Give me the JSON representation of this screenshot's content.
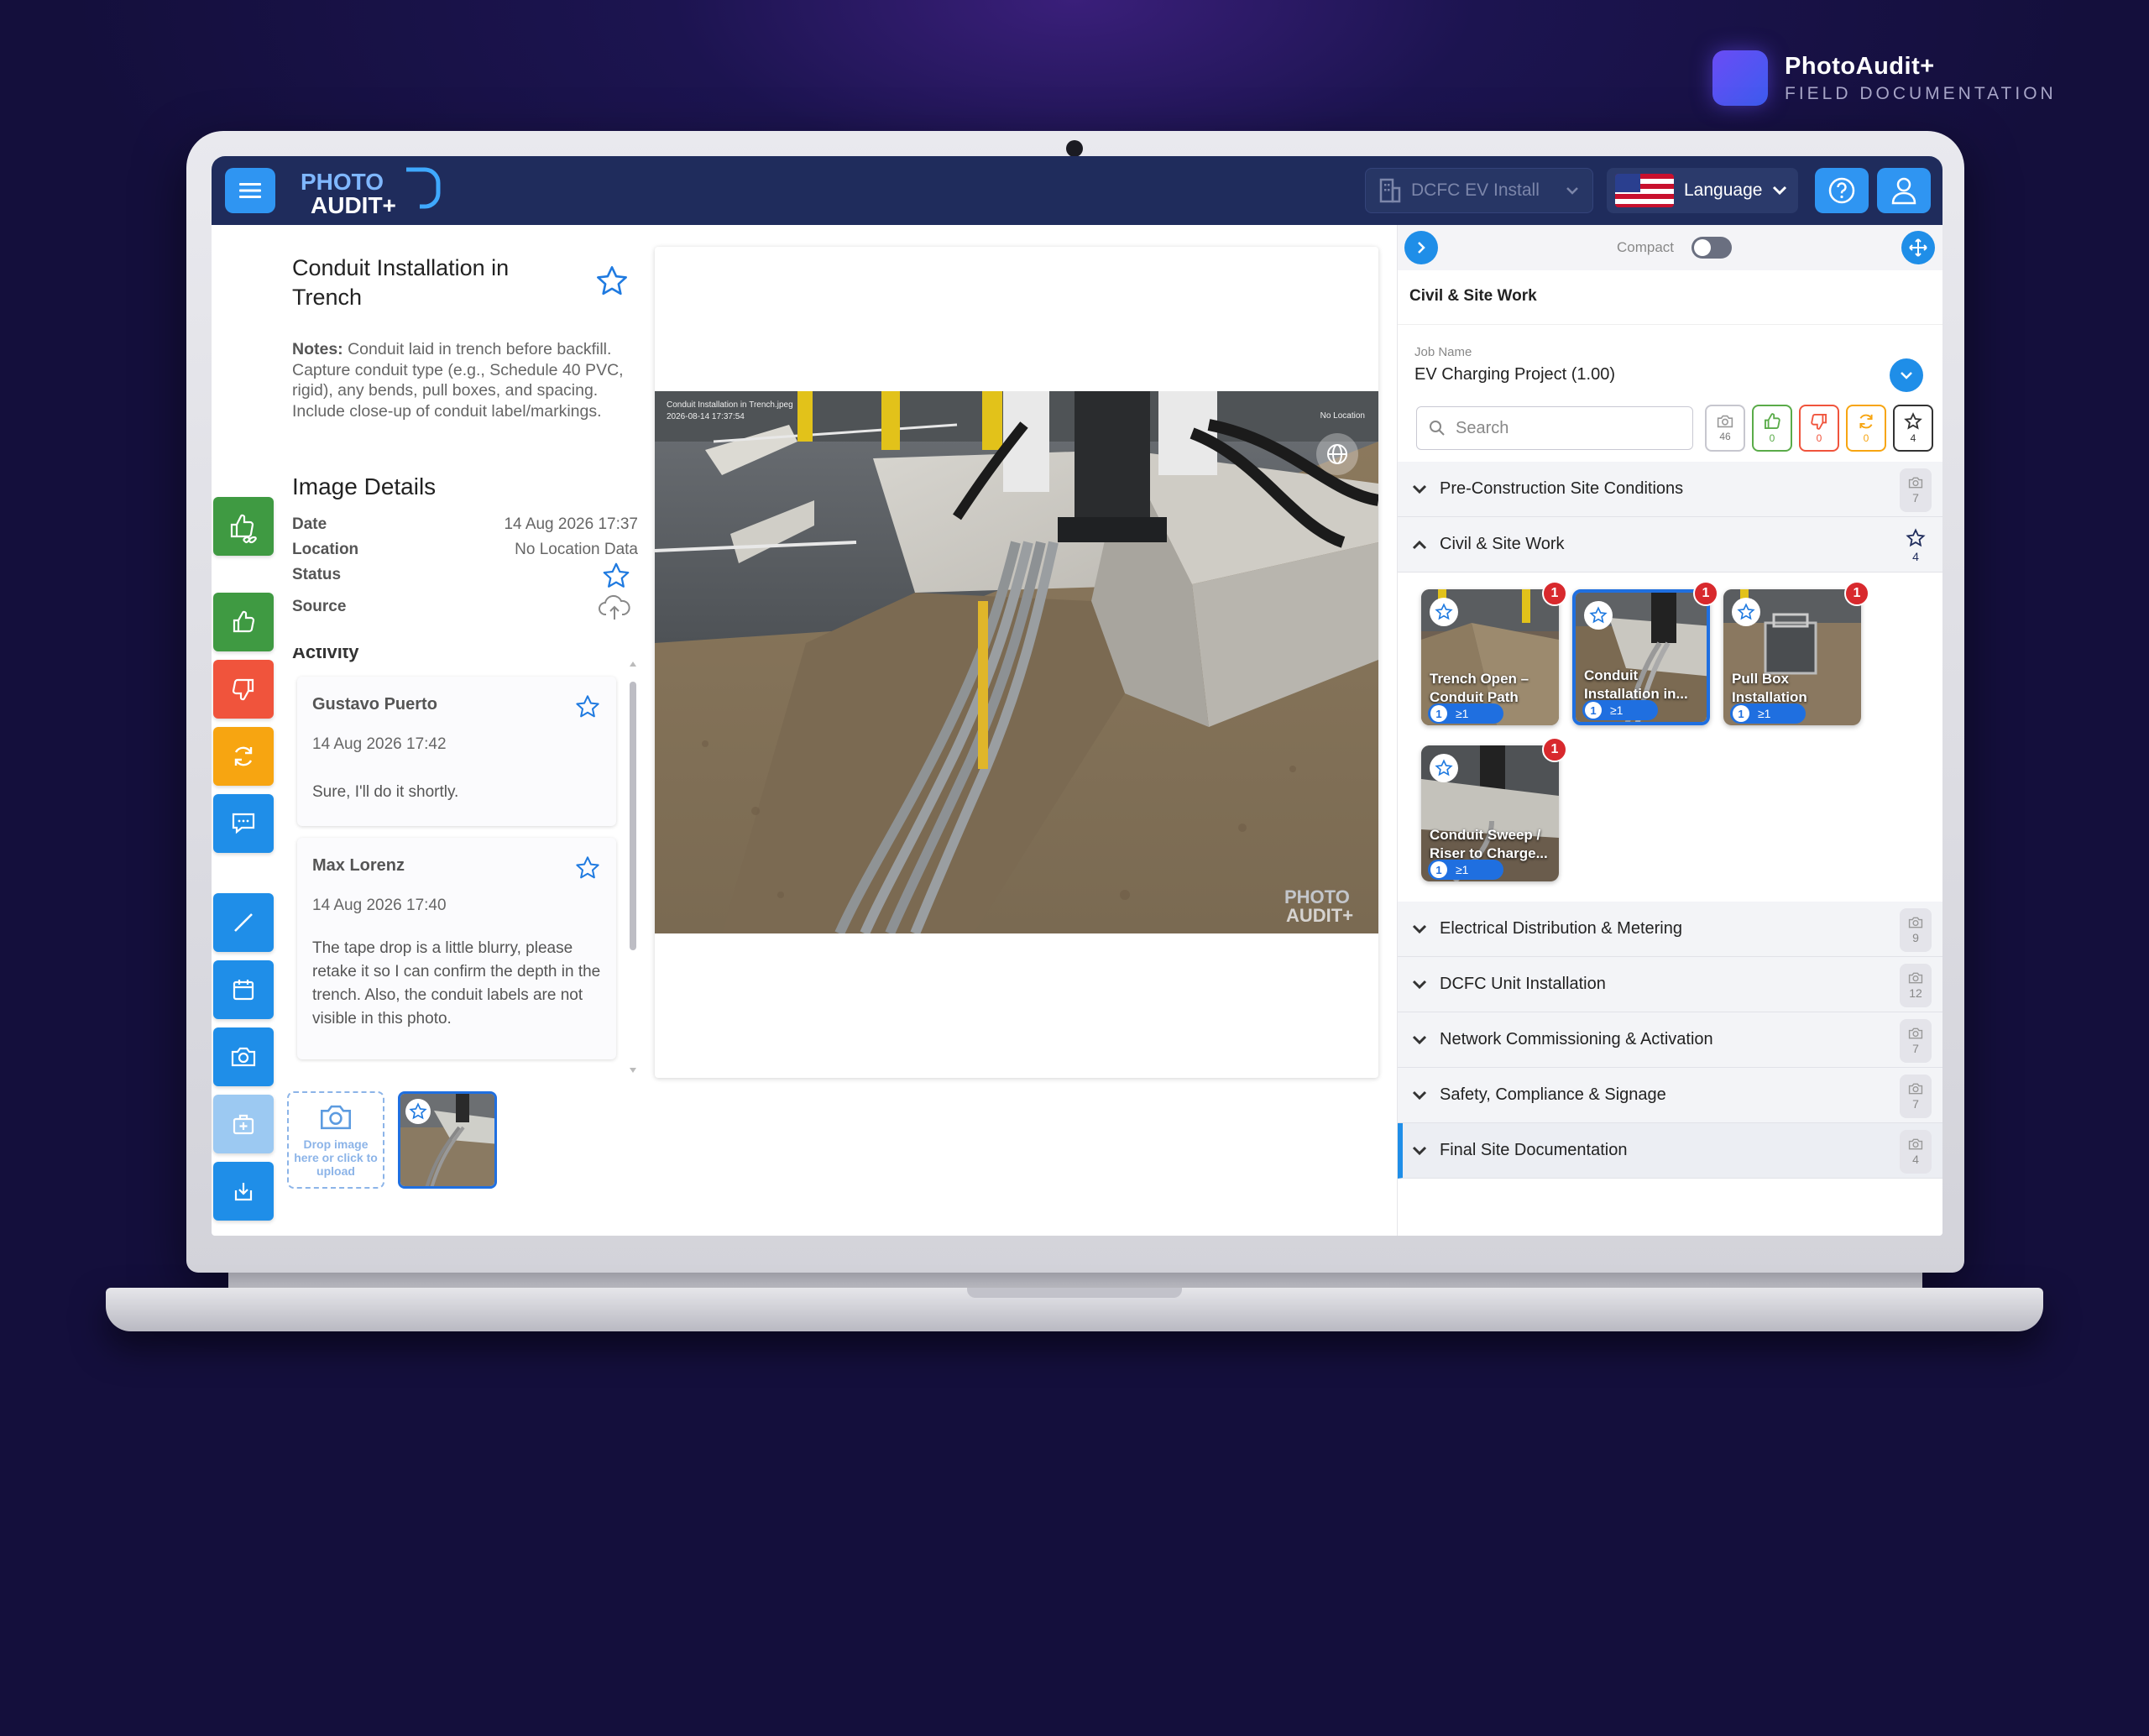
{
  "brand": {
    "name": "PhotoAudit+",
    "tagline": "FIELD DOCUMENTATION"
  },
  "topbar": {
    "logo_line1": "PHOTO",
    "logo_line2": "AUDIT+",
    "project": "DCFC EV Install",
    "language": "Language"
  },
  "info": {
    "title": "Conduit Installation in Trench",
    "notes_label": "Notes:",
    "notes": " Conduit laid in trench before backfill. Capture conduit type (e.g., Schedule 40 PVC, rigid), any bends, pull boxes, and spacing. Include close-up of conduit label/markings."
  },
  "details": {
    "heading": "Image Details",
    "date_label": "Date",
    "date_value": "14 Aug 2026 17:37",
    "location_label": "Location",
    "location_value": "No Location Data",
    "status_label": "Status",
    "source_label": "Source"
  },
  "activity": {
    "label": "Activity",
    "comments": [
      {
        "author": "Gustavo Puerto",
        "time": "14 Aug 2026 17:42",
        "text": "Sure, I'll do it shortly."
      },
      {
        "author": "Max Lorenz",
        "time": "14 Aug 2026 17:40",
        "text": "The tape drop is a little blurry, please retake it so I can confirm the depth in the trench. Also, the conduit labels are not visible in this photo."
      }
    ]
  },
  "dropzone": {
    "text": "Drop image here or click to upload"
  },
  "photo": {
    "caption_line1": "Conduit Installation in Trench.jpeg",
    "caption_line2": "2026-08-14 17:37:54",
    "location_tag": "No Location"
  },
  "right_panel": {
    "compact_label": "Compact",
    "section_title": "Civil & Site Work",
    "job_label": "Job Name",
    "job_value": "EV Charging Project (1.00)",
    "search_placeholder": "Search",
    "filters": {
      "all": "46",
      "approved": "0",
      "rejected": "0",
      "retake": "0",
      "starred": "4"
    },
    "categories": [
      {
        "name": "Pre-Construction Site Conditions",
        "count": "7"
      },
      {
        "name": "Civil & Site Work",
        "count": "4"
      },
      {
        "name": "Electrical Distribution & Metering",
        "count": "9"
      },
      {
        "name": "DCFC Unit Installation",
        "count": "12"
      },
      {
        "name": "Network Commissioning & Activation",
        "count": "7"
      },
      {
        "name": "Safety, Compliance & Signage",
        "count": "7"
      },
      {
        "name": "Final Site Documentation",
        "count": "4"
      }
    ],
    "tiles": [
      {
        "label": "Trench Open – Conduit Path",
        "badge": "1",
        "pill_a": "1",
        "pill_b": "≥1"
      },
      {
        "label": "Conduit Installation in...",
        "badge": "1",
        "pill_a": "1",
        "pill_b": "≥1"
      },
      {
        "label": "Pull Box Installation",
        "badge": "1",
        "pill_a": "1",
        "pill_b": "≥1"
      },
      {
        "label": "Conduit Sweep / Riser to Charge...",
        "badge": "1",
        "pill_a": "1",
        "pill_b": "≥1"
      }
    ]
  },
  "colors": {
    "primary": "#1f8ee8",
    "navbar": "#1f2c5c",
    "approve": "#3f9a42",
    "reject": "#f0543c",
    "retake": "#f7a511"
  }
}
